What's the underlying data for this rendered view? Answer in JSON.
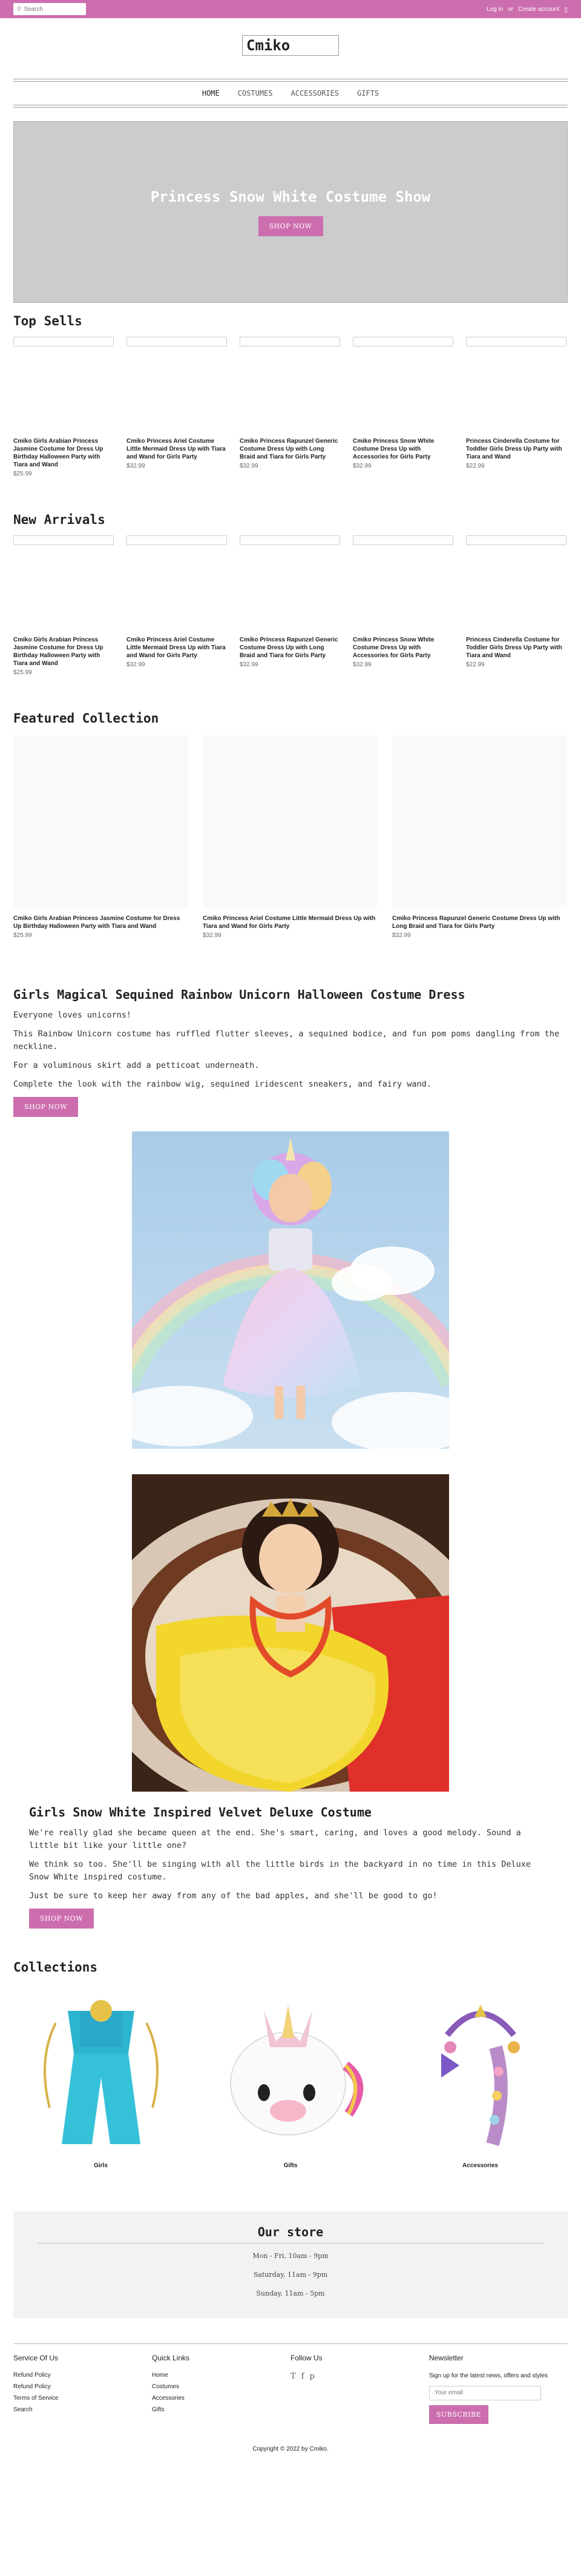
{
  "topbar": {
    "search_placeholder": "Search",
    "login": "Log in",
    "or": "or",
    "create_account": "Create account"
  },
  "store_name": "Cmiko",
  "nav": [
    "HOME",
    "COSTUMES",
    "ACCESSORIES",
    "GIFTS"
  ],
  "hero": {
    "title": "Princess Snow White Costume Show",
    "button": "SHOP NOW"
  },
  "top_sells": {
    "title": "Top Sells",
    "products": [
      {
        "title": "Cmiko Girls Arabian Princess Jasmine Costume for Dress Up Birthday Halloween Party with Tiara and Wand",
        "price": "$25.99"
      },
      {
        "title": "Cmiko Princess Ariel Costume Little Mermaid Dress Up with Tiara and Wand for Girls Party",
        "price": "$32.99"
      },
      {
        "title": "Cmiko Princess Rapunzel Generic Costume Dress Up with Long Braid and Tiara for Girls Party",
        "price": "$32.99"
      },
      {
        "title": "Cmiko Princess Snow White Costume Dress Up with Accessories for Girls Party",
        "price": "$32.99"
      },
      {
        "title": "Princess Cinderella Costume for Toddler Girls Dress Up Party with Tiara and Wand",
        "price": "$22.99"
      }
    ]
  },
  "new_arrivals": {
    "title": "New Arrivals",
    "products": [
      {
        "title": "Cmiko Girls Arabian Princess Jasmine Costume for Dress Up Birthday Halloween Party with Tiara and Wand",
        "price": "$25.99"
      },
      {
        "title": "Cmiko Princess Ariel Costume Little Mermaid Dress Up with Tiara and Wand for Girls Party",
        "price": "$32.99"
      },
      {
        "title": "Cmiko Princess Rapunzel Generic Costume Dress Up with Long Braid and Tiara for Girls Party",
        "price": "$32.99"
      },
      {
        "title": "Cmiko Princess Snow White Costume Dress Up with Accessories for Girls Party",
        "price": "$32.99"
      },
      {
        "title": "Princess Cinderella Costume for Toddler Girls Dress Up Party with Tiara and Wand",
        "price": "$22.99"
      }
    ]
  },
  "featured": {
    "title": "Featured Collection",
    "products": [
      {
        "title": "Cmiko Girls Arabian Princess Jasmine Costume for Dress Up Birthday Halloween Party with Tiara and Wand",
        "price": "$25.99"
      },
      {
        "title": "Cmiko Princess Ariel Costume Little Mermaid Dress Up with Tiara and Wand for Girls Party",
        "price": "$32.99"
      },
      {
        "title": "Cmiko Princess Rapunzel Generic Costume Dress Up with Long Braid and Tiara for Girls Party",
        "price": "$32.99"
      }
    ]
  },
  "unicorn": {
    "title": "Girls Magical Sequined Rainbow Unicorn Halloween Costume Dress",
    "p1": "Everyone loves unicorns!",
    "p2": "This Rainbow Unicorn costume has ruffled flutter sleeves, a sequined bodice, and fun pom poms dangling from the neckline.",
    "p3": "For a voluminous skirt add a petticoat underneath.",
    "p4": "Complete the look with the rainbow wig, sequined iridescent sneakers, and fairy wand.",
    "button": "SHOP NOW"
  },
  "snow_white": {
    "title": "Girls Snow White Inspired Velvet Deluxe Costume",
    "p1": "We're really glad she became queen at the end. She's smart, caring, and loves a good melody. Sound a little bit like your little one?",
    "p2": "We think so too. She'll be singing with all the little birds in the backyard in no time in this Deluxe Snow White inspired costume.",
    "p3": "Just be sure to keep her away from any of the bad apples, and she'll be good to go!",
    "button": "SHOP NOW"
  },
  "collections": {
    "title": "Collections",
    "items": [
      {
        "label": "Girls"
      },
      {
        "label": "Gifts"
      },
      {
        "label": "Accessories"
      }
    ]
  },
  "our_store": {
    "title": "Our store",
    "hours1": "Mon - Fri, 10am - 9pm",
    "hours2": "Saturday, 11am - 9pm",
    "hours3": "Sunday, 11am - 5pm"
  },
  "footer": {
    "service_title": "Service Of Us",
    "service_links": [
      "Refund Policy",
      "Refund Policy",
      "Terms of Service",
      "Search"
    ],
    "quick_title": "Quick Links",
    "quick_links": [
      "Home",
      "Costumes",
      "Accessories",
      "Gifts"
    ],
    "follow_title": "Follow Us",
    "social": [
      "T",
      "f",
      "p"
    ],
    "newsletter_title": "Newsletter",
    "newsletter_text": "Sign up for the latest news, offers and styles",
    "newsletter_placeholder": "Your email",
    "subscribe": "SUBSCRIBE",
    "copyright": "Copyright © 2022 by Cmiko."
  },
  "colors": {
    "accent": "#cc6eae",
    "hero_bg": "#cccccc",
    "store_bg": "#f2f2f2"
  }
}
